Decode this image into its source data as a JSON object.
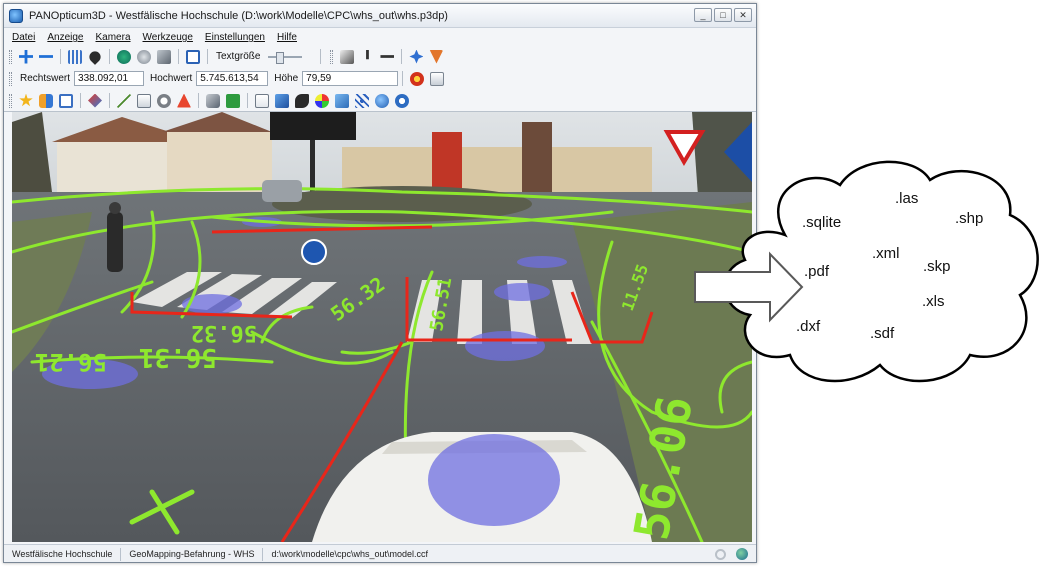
{
  "window": {
    "title": "PANOpticum3D - Westfälische Hochschule (D:\\work\\Modelle\\CPC\\whs_out\\whs.p3dp)",
    "controls": {
      "minimize": "_",
      "maximize": "□",
      "close": "✕"
    }
  },
  "menu": [
    "Datei",
    "Anzeige",
    "Kamera",
    "Werkzeuge",
    "Einstellungen",
    "Hilfe"
  ],
  "toolbar1": {
    "font_size_label": "Textgröße"
  },
  "coordinates": {
    "rechtswert_label": "Rechtswert",
    "rechtswert_value": "338.092,01",
    "hochwert_label": "Hochwert",
    "hochwert_value": "5.745.613,54",
    "hoehe_label": "Höhe",
    "hoehe_value": "79,59"
  },
  "overlay_labels": {
    "label_a": "56.32",
    "label_b": "56.51",
    "label_c": "56.31",
    "label_d": "56.06",
    "label_e": "56.21",
    "label_f": "11.55",
    "label_g": "56.32"
  },
  "statusbar": {
    "organisation": "Westfälische Hochschule",
    "project": "GeoMapping-Befahrung - WHS",
    "model_path": "d:\\work\\modelle\\cpc\\whs_out\\model.ccf"
  },
  "export_formats": [
    ".sqlite",
    ".las",
    ".shp",
    ".xml",
    ".pdf",
    ".skp",
    ".xls",
    ".dxf",
    ".sdf"
  ],
  "colors": {
    "point_cloud_green": "#8ee82e",
    "breakline_red": "#e8261a",
    "manhole_blue": "#6f6fe0",
    "window_chrome": "#f3f5f8"
  }
}
